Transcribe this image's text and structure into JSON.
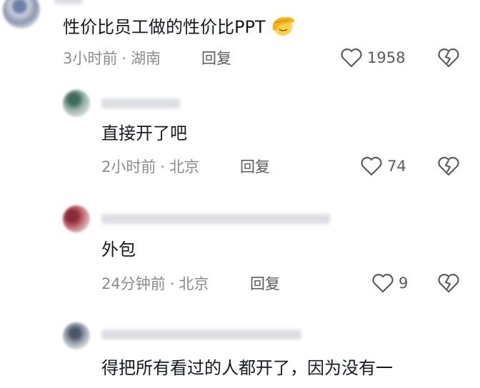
{
  "comments": [
    {
      "text": "性价比员工做的性价比PPT",
      "emoji": "facepalm-emoji",
      "time": "3小时前",
      "location": "湖南",
      "reply": "回复",
      "likes": "1958"
    }
  ],
  "replies": [
    {
      "text": "直接开了吧",
      "time": "2小时前",
      "location": "北京",
      "reply": "回复",
      "likes": "74"
    },
    {
      "text": "外包",
      "time": "24分钟前",
      "location": "北京",
      "reply": "回复",
      "likes": "9"
    },
    {
      "text": "得把所有看过的人都开了，因为没有一"
    }
  ],
  "meta_separator": "·",
  "colors": {
    "text": "#161823",
    "meta": "#8a8b91",
    "action": "#5a5b61"
  }
}
